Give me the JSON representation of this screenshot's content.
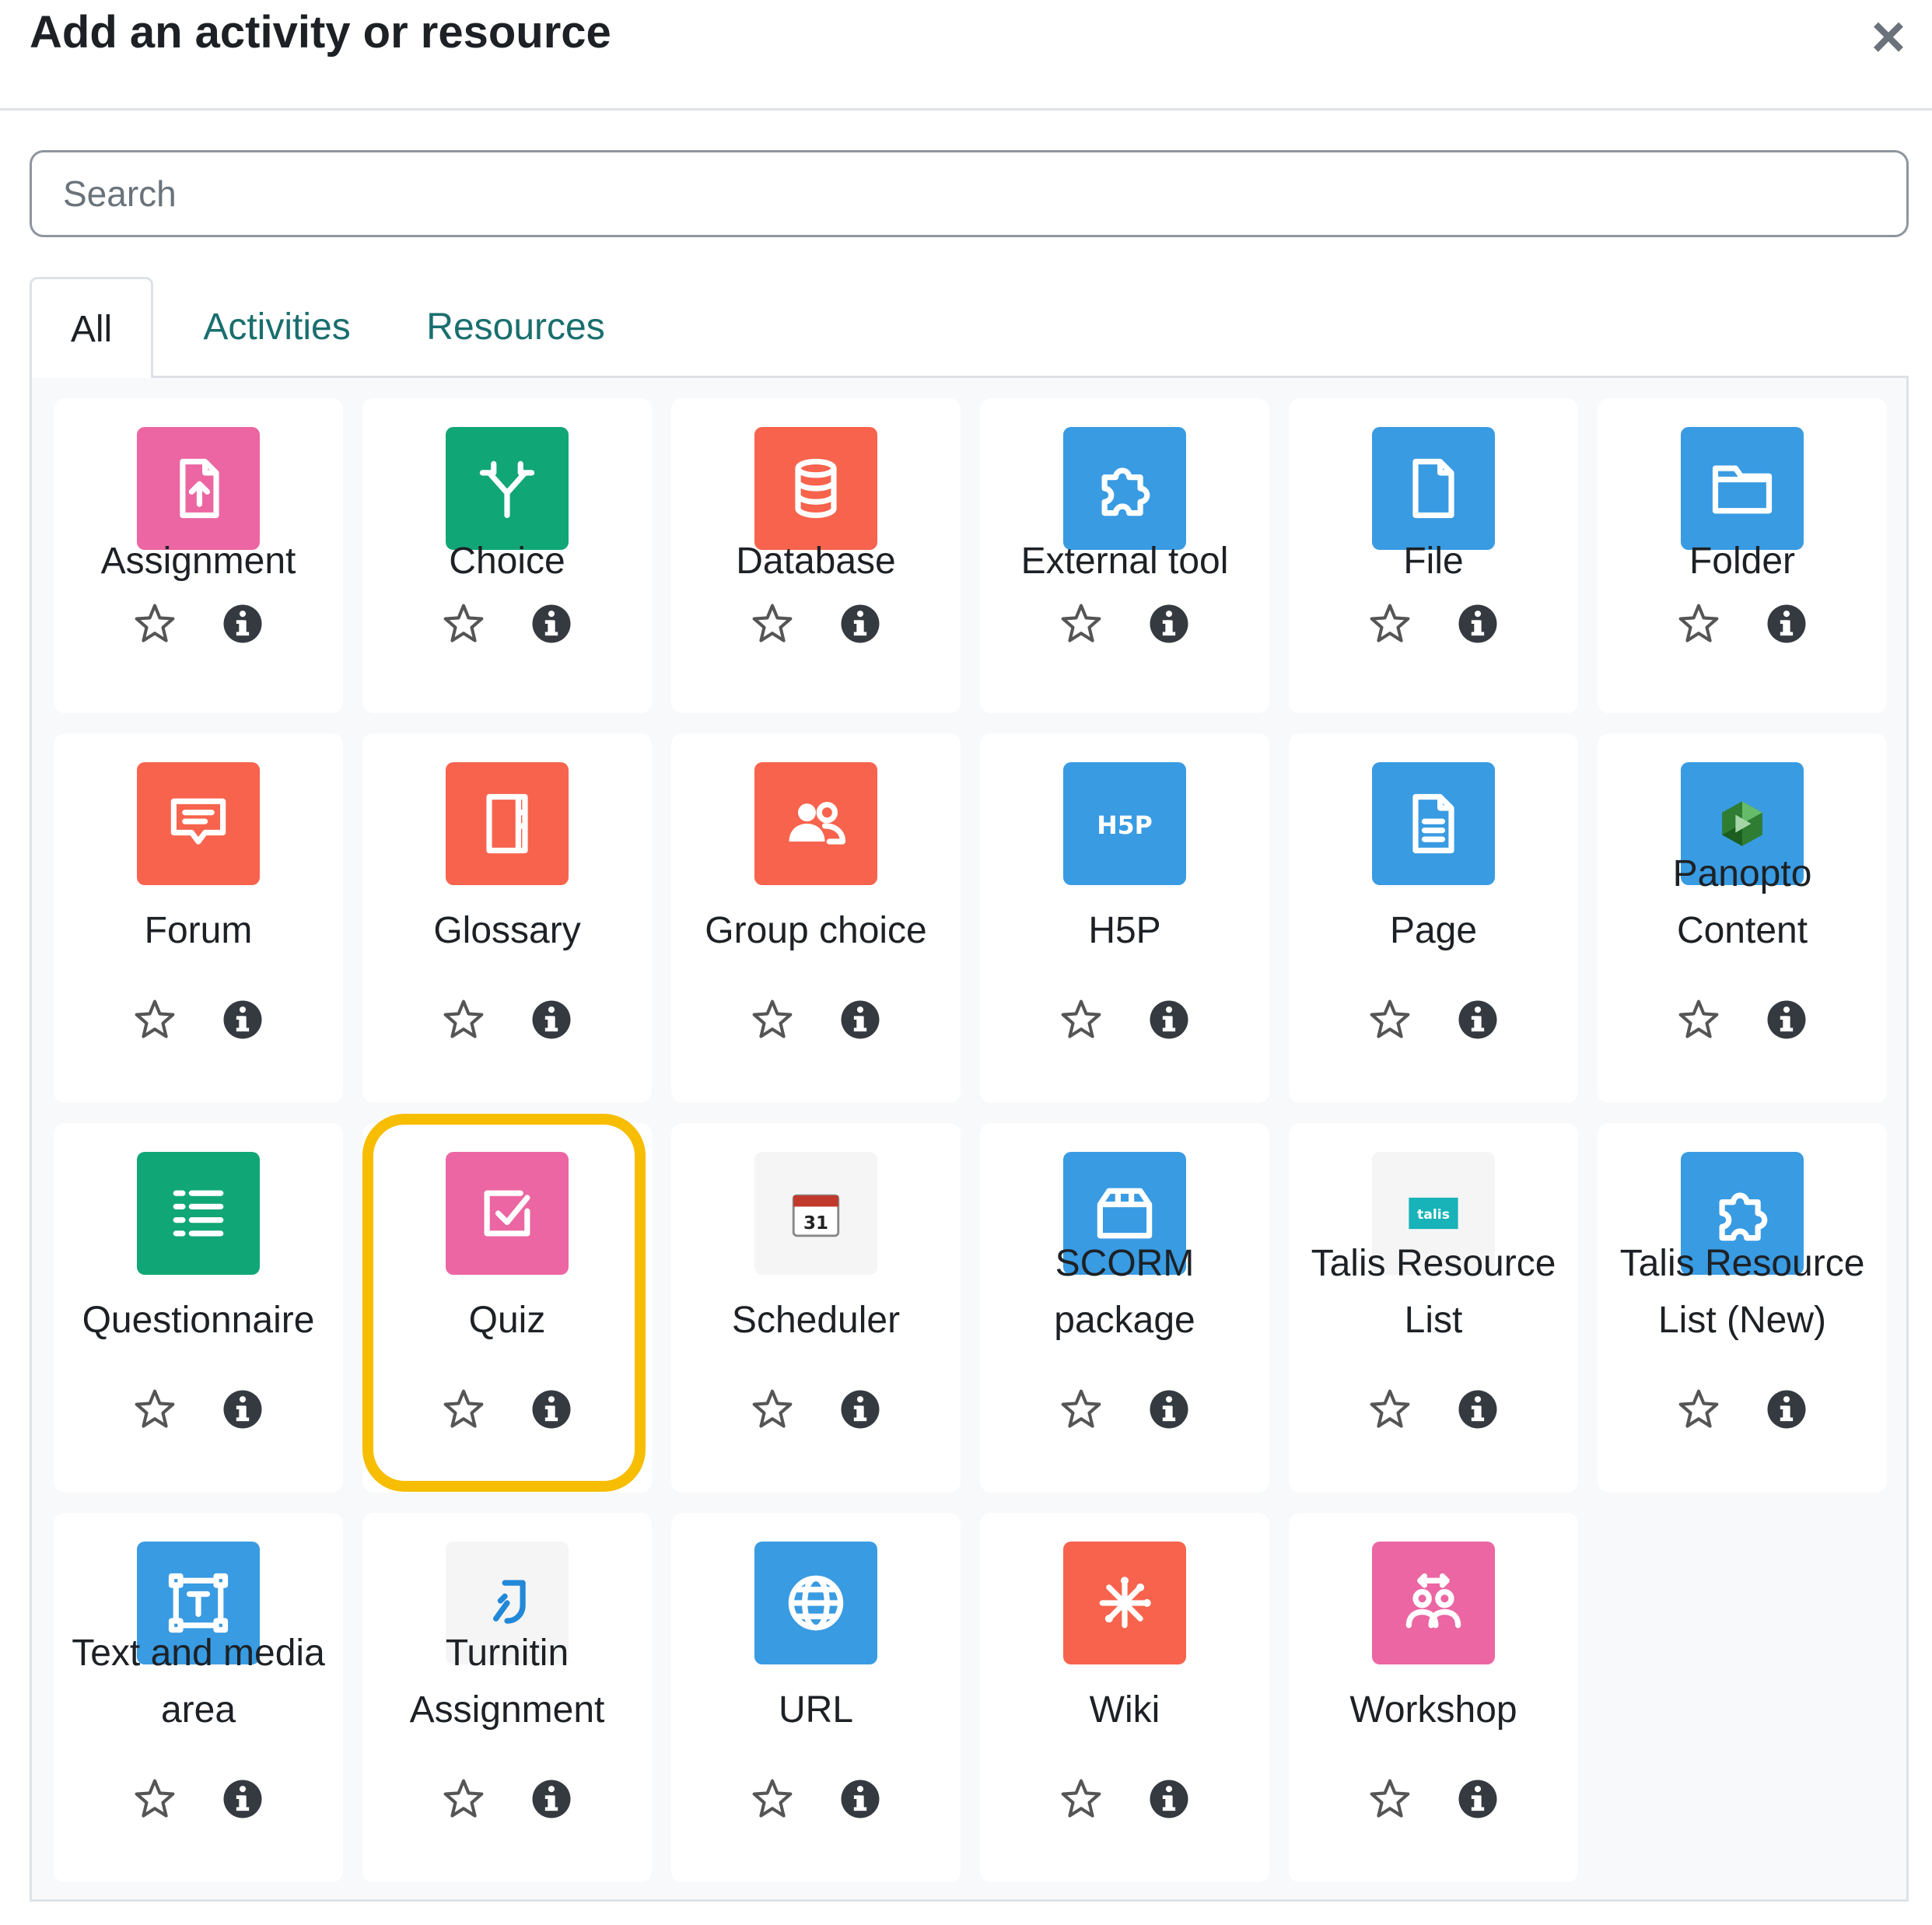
{
  "header": {
    "title": "Add an activity or resource",
    "close_label": "×"
  },
  "search": {
    "placeholder": "Search"
  },
  "tabs": [
    {
      "label": "All",
      "active": true
    },
    {
      "label": "Activities",
      "active": false
    },
    {
      "label": "Resources",
      "active": false
    }
  ],
  "highlighted_item": "Quiz",
  "items": [
    {
      "line1": "Assignment",
      "line2": "",
      "icon": "assignment-icon",
      "color": "#eb66a2"
    },
    {
      "line1": "Choice",
      "line2": "",
      "icon": "choice-icon",
      "color": "#11a676"
    },
    {
      "line1": "Database",
      "line2": "",
      "icon": "database-icon",
      "color": "#f7634d"
    },
    {
      "line1": "External tool",
      "line2": "",
      "icon": "external-tool-icon",
      "color": "#399be2"
    },
    {
      "line1": "File",
      "line2": "",
      "icon": "file-icon",
      "color": "#399be2"
    },
    {
      "line1": "Folder",
      "line2": "",
      "icon": "folder-icon",
      "color": "#399be2"
    },
    {
      "line1": "Forum",
      "line2": "",
      "icon": "forum-icon",
      "color": "#f7634d"
    },
    {
      "line1": "Glossary",
      "line2": "",
      "icon": "glossary-icon",
      "color": "#f7634d"
    },
    {
      "line1": "Group choice",
      "line2": "",
      "icon": "group-choice-icon",
      "color": "#f7634d"
    },
    {
      "line1": "H5P",
      "line2": "",
      "icon": "h5p-icon",
      "color": "#399be2"
    },
    {
      "line1": "Page",
      "line2": "",
      "icon": "page-icon",
      "color": "#399be2"
    },
    {
      "line1": "Panopto",
      "line2": "Content",
      "icon": "panopto-icon",
      "color": "#399be2"
    },
    {
      "line1": "Questionnaire",
      "line2": "",
      "icon": "questionnaire-icon",
      "color": "#11a676"
    },
    {
      "line1": "Quiz",
      "line2": "",
      "icon": "quiz-icon",
      "color": "#eb66a2"
    },
    {
      "line1": "Scheduler",
      "line2": "",
      "icon": "scheduler-icon",
      "color": "#f5f5f5"
    },
    {
      "line1": "SCORM",
      "line2": "package",
      "icon": "scorm-icon",
      "color": "#399be2"
    },
    {
      "line1": "Talis Resource",
      "line2": "List",
      "icon": "talis-icon",
      "color": "#f5f5f5"
    },
    {
      "line1": "Talis Resource",
      "line2": "List (New)",
      "icon": "puzzle-icon",
      "color": "#399be2"
    },
    {
      "line1": "Text and media",
      "line2": "area",
      "icon": "text-media-icon",
      "color": "#399be2"
    },
    {
      "line1": "Turnitin",
      "line2": "Assignment",
      "icon": "turnitin-icon",
      "color": "#f5f5f5"
    },
    {
      "line1": "URL",
      "line2": "",
      "icon": "url-icon",
      "color": "#399be2"
    },
    {
      "line1": "Wiki",
      "line2": "",
      "icon": "wiki-icon",
      "color": "#f7634d"
    },
    {
      "line1": "Workshop",
      "line2": "",
      "icon": "workshop-icon",
      "color": "#eb66a2"
    }
  ]
}
